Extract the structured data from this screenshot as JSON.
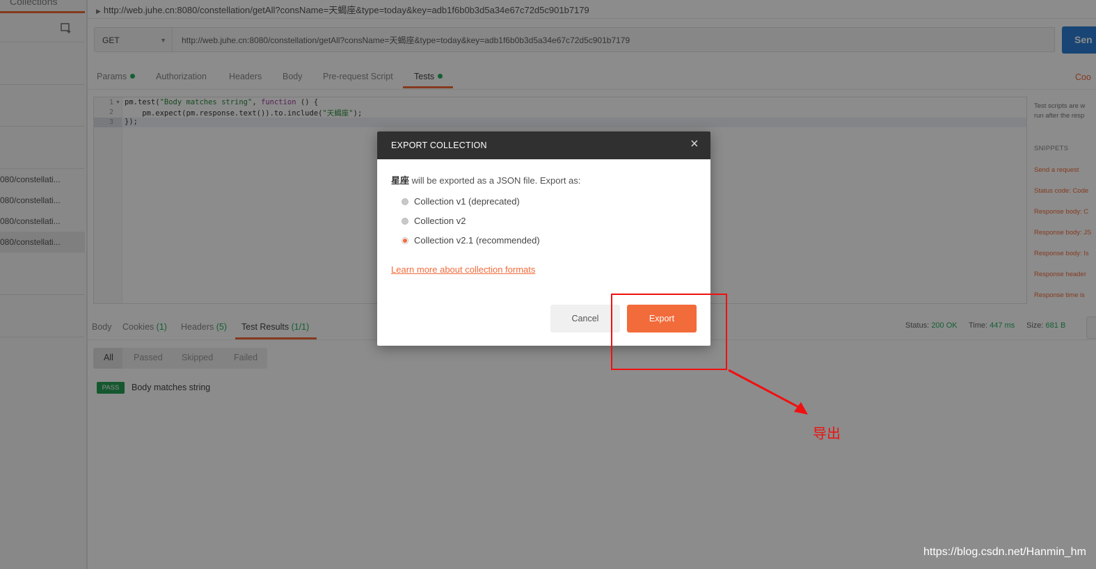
{
  "sidebar": {
    "title": "Collections",
    "items": [
      "080/constellati...",
      "080/constellati...",
      "080/constellati...",
      "080/constellati..."
    ]
  },
  "request": {
    "title": "http://web.juhe.cn:8080/constellation/getAll?consName=天蝎座&type=today&key=adb1f6b0b3d5a34e67c72d5c901b7179",
    "method": "GET",
    "url": "http://web.juhe.cn:8080/constellation/getAll?consName=天蝎座&type=today&key=adb1f6b0b3d5a34e67c72d5c901b7179",
    "send_label": "Sen"
  },
  "tabs": [
    "Params",
    "Authorization",
    "Headers",
    "Body",
    "Pre-request Script",
    "Tests"
  ],
  "cookies_link": "Coo",
  "editor": {
    "line_numbers": [
      "1",
      "2",
      "3"
    ],
    "line1": {
      "a": "pm.test(",
      "b": "\"Body matches string\"",
      "c": ", ",
      "d": "function",
      "e": " () {"
    },
    "line2": {
      "a": "    pm.expect(pm.response.text()).to.include(",
      "b": "\"天蝎座\"",
      "c": ");"
    },
    "line3": "});"
  },
  "snippets": {
    "desc1": "Test scripts are w",
    "desc2": "run after the resp",
    "heading": "SNIPPETS",
    "items": [
      "Send a request",
      "Status code: Code",
      "Response body: C",
      "Response body: JS",
      "Response body: Is",
      "Response header",
      "Response time is"
    ]
  },
  "response": {
    "tabs": {
      "body": "Body",
      "cookies": "Cookies",
      "cookies_count": "(1)",
      "headers": "Headers",
      "headers_count": "(5)",
      "tests": "Test Results",
      "tests_count": "(1/1)"
    },
    "status_label": "Status:",
    "status_value": "200 OK",
    "time_label": "Time:",
    "time_value": "447 ms",
    "size_label": "Size:",
    "size_value": "681 B",
    "filters": [
      "All",
      "Passed",
      "Skipped",
      "Failed"
    ],
    "result_badge": "PASS",
    "result_name": "Body matches string"
  },
  "modal": {
    "title": "EXPORT COLLECTION",
    "collection_name": "星座",
    "desc_rest": " will be exported as a JSON file. Export as:",
    "options": [
      "Collection v1 (deprecated)",
      "Collection v2",
      "Collection v2.1 (recommended)"
    ],
    "selected_option": "Collection v2.1 (recommended)",
    "learn_more": "Learn more about collection formats",
    "cancel": "Cancel",
    "export": "Export",
    "close_icon": "×"
  },
  "annotation": {
    "label": "导出",
    "color": "#f01010"
  },
  "watermark": "https://blog.csdn.net/Hanmin_hm",
  "colors": {
    "accent": "#f26b3a",
    "send": "#2d7fd6",
    "success": "#27ae60"
  }
}
